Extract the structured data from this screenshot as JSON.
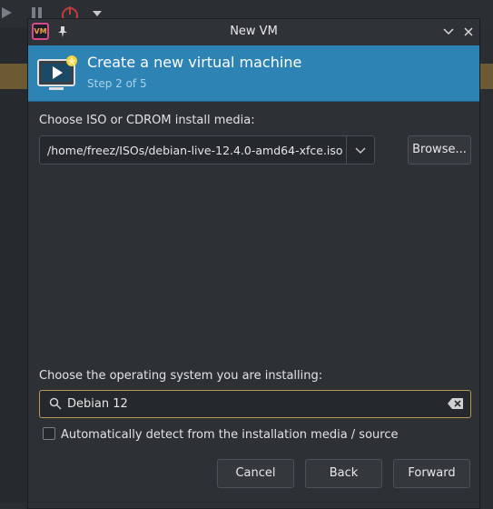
{
  "dialog": {
    "title": "New VM",
    "app_icon_text": "VM",
    "header": {
      "title": "Create a new virtual machine",
      "step": "Step 2 of 5"
    },
    "install_media": {
      "label": "Choose ISO or CDROM install media:",
      "value": "/home/freez/ISOs/debian-live-12.4.0-amd64-xfce.iso",
      "browse_label": "Browse..."
    },
    "os": {
      "label": "Choose the operating system you are installing:",
      "value": "Debian 12"
    },
    "auto_detect": {
      "label": "Automatically detect from the installation media / source",
      "checked": false
    },
    "buttons": {
      "cancel": "Cancel",
      "back": "Back",
      "forward": "Forward"
    }
  },
  "colors": {
    "header_bg": "#2e83b5",
    "dialog_bg": "#2d3136",
    "search_border": "#b89a55",
    "step_text": "#a9d2ea"
  }
}
